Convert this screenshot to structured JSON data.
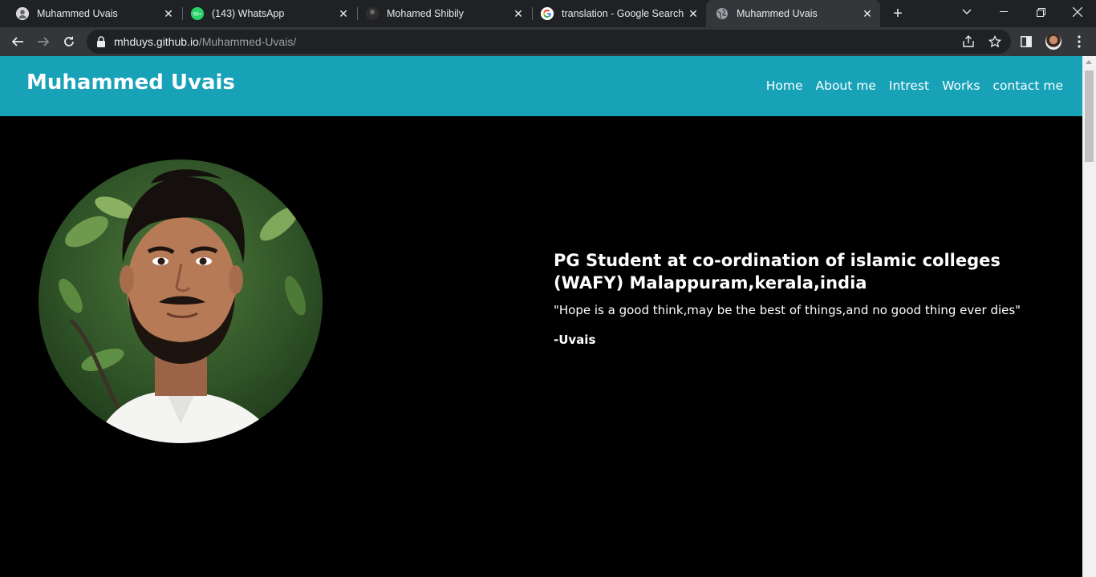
{
  "browser": {
    "tabs": [
      {
        "title": "Muhammed Uvais",
        "favicon": "avatar-icon",
        "active": false
      },
      {
        "title": "(143) WhatsApp",
        "favicon": "whatsapp-icon",
        "badge": "99+",
        "active": false
      },
      {
        "title": "Mohamed Shibily",
        "favicon": "avatar-icon",
        "active": false
      },
      {
        "title": "translation - Google Search",
        "favicon": "google-icon",
        "active": false
      },
      {
        "title": "Muhammed Uvais",
        "favicon": "globe-icon",
        "active": true
      }
    ],
    "address": {
      "domain": "mhduys.github.io",
      "path": "/Muhammed-Uvais/"
    },
    "colors": {
      "tabstrip": "#202124",
      "toolbar": "#35363a",
      "omnibox": "#202124"
    }
  },
  "site": {
    "brand": "Muhammed Uvais",
    "nav": [
      "Home",
      "About me",
      "Intrest",
      "Works",
      "contact me"
    ],
    "headline": "PG Student at co-ordination of islamic colleges (WAFY) Malappuram,kerala,india",
    "quote": "\"Hope is a good think,may be the best of things,and no good thing ever dies\"",
    "signature": "-Uvais",
    "colors": {
      "header": "#17a2b8",
      "background": "#000000",
      "text": "#ffffff"
    }
  }
}
